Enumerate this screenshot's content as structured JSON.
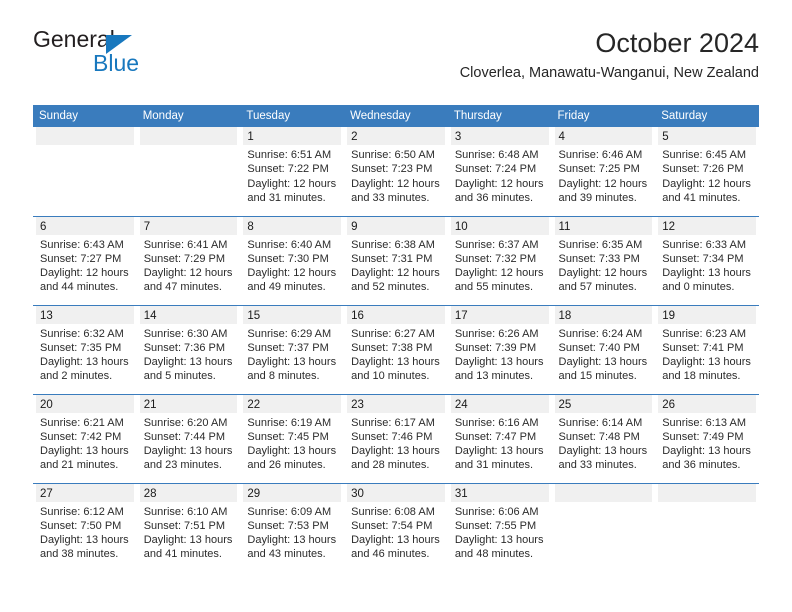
{
  "logo": {
    "word1": "General",
    "word2": "Blue",
    "triangle_color": "#1878be"
  },
  "header": {
    "title": "October 2024",
    "subtitle": "Cloverlea, Manawatu-Wanganui, New Zealand"
  },
  "colors": {
    "header_blue": "#3a7cbd",
    "daynum_band": "#f0f0f0",
    "text": "#1a1a1a"
  },
  "calendar": {
    "weekday_headers": [
      "Sunday",
      "Monday",
      "Tuesday",
      "Wednesday",
      "Thursday",
      "Friday",
      "Saturday"
    ],
    "weeks": [
      [
        {
          "day": "",
          "sunrise": "",
          "sunset": "",
          "daylight_line1": "",
          "daylight_line2": ""
        },
        {
          "day": "",
          "sunrise": "",
          "sunset": "",
          "daylight_line1": "",
          "daylight_line2": ""
        },
        {
          "day": "1",
          "sunrise": "Sunrise: 6:51 AM",
          "sunset": "Sunset: 7:22 PM",
          "daylight_line1": "Daylight: 12 hours",
          "daylight_line2": "and 31 minutes."
        },
        {
          "day": "2",
          "sunrise": "Sunrise: 6:50 AM",
          "sunset": "Sunset: 7:23 PM",
          "daylight_line1": "Daylight: 12 hours",
          "daylight_line2": "and 33 minutes."
        },
        {
          "day": "3",
          "sunrise": "Sunrise: 6:48 AM",
          "sunset": "Sunset: 7:24 PM",
          "daylight_line1": "Daylight: 12 hours",
          "daylight_line2": "and 36 minutes."
        },
        {
          "day": "4",
          "sunrise": "Sunrise: 6:46 AM",
          "sunset": "Sunset: 7:25 PM",
          "daylight_line1": "Daylight: 12 hours",
          "daylight_line2": "and 39 minutes."
        },
        {
          "day": "5",
          "sunrise": "Sunrise: 6:45 AM",
          "sunset": "Sunset: 7:26 PM",
          "daylight_line1": "Daylight: 12 hours",
          "daylight_line2": "and 41 minutes."
        }
      ],
      [
        {
          "day": "6",
          "sunrise": "Sunrise: 6:43 AM",
          "sunset": "Sunset: 7:27 PM",
          "daylight_line1": "Daylight: 12 hours",
          "daylight_line2": "and 44 minutes."
        },
        {
          "day": "7",
          "sunrise": "Sunrise: 6:41 AM",
          "sunset": "Sunset: 7:29 PM",
          "daylight_line1": "Daylight: 12 hours",
          "daylight_line2": "and 47 minutes."
        },
        {
          "day": "8",
          "sunrise": "Sunrise: 6:40 AM",
          "sunset": "Sunset: 7:30 PM",
          "daylight_line1": "Daylight: 12 hours",
          "daylight_line2": "and 49 minutes."
        },
        {
          "day": "9",
          "sunrise": "Sunrise: 6:38 AM",
          "sunset": "Sunset: 7:31 PM",
          "daylight_line1": "Daylight: 12 hours",
          "daylight_line2": "and 52 minutes."
        },
        {
          "day": "10",
          "sunrise": "Sunrise: 6:37 AM",
          "sunset": "Sunset: 7:32 PM",
          "daylight_line1": "Daylight: 12 hours",
          "daylight_line2": "and 55 minutes."
        },
        {
          "day": "11",
          "sunrise": "Sunrise: 6:35 AM",
          "sunset": "Sunset: 7:33 PM",
          "daylight_line1": "Daylight: 12 hours",
          "daylight_line2": "and 57 minutes."
        },
        {
          "day": "12",
          "sunrise": "Sunrise: 6:33 AM",
          "sunset": "Sunset: 7:34 PM",
          "daylight_line1": "Daylight: 13 hours",
          "daylight_line2": "and 0 minutes."
        }
      ],
      [
        {
          "day": "13",
          "sunrise": "Sunrise: 6:32 AM",
          "sunset": "Sunset: 7:35 PM",
          "daylight_line1": "Daylight: 13 hours",
          "daylight_line2": "and 2 minutes."
        },
        {
          "day": "14",
          "sunrise": "Sunrise: 6:30 AM",
          "sunset": "Sunset: 7:36 PM",
          "daylight_line1": "Daylight: 13 hours",
          "daylight_line2": "and 5 minutes."
        },
        {
          "day": "15",
          "sunrise": "Sunrise: 6:29 AM",
          "sunset": "Sunset: 7:37 PM",
          "daylight_line1": "Daylight: 13 hours",
          "daylight_line2": "and 8 minutes."
        },
        {
          "day": "16",
          "sunrise": "Sunrise: 6:27 AM",
          "sunset": "Sunset: 7:38 PM",
          "daylight_line1": "Daylight: 13 hours",
          "daylight_line2": "and 10 minutes."
        },
        {
          "day": "17",
          "sunrise": "Sunrise: 6:26 AM",
          "sunset": "Sunset: 7:39 PM",
          "daylight_line1": "Daylight: 13 hours",
          "daylight_line2": "and 13 minutes."
        },
        {
          "day": "18",
          "sunrise": "Sunrise: 6:24 AM",
          "sunset": "Sunset: 7:40 PM",
          "daylight_line1": "Daylight: 13 hours",
          "daylight_line2": "and 15 minutes."
        },
        {
          "day": "19",
          "sunrise": "Sunrise: 6:23 AM",
          "sunset": "Sunset: 7:41 PM",
          "daylight_line1": "Daylight: 13 hours",
          "daylight_line2": "and 18 minutes."
        }
      ],
      [
        {
          "day": "20",
          "sunrise": "Sunrise: 6:21 AM",
          "sunset": "Sunset: 7:42 PM",
          "daylight_line1": "Daylight: 13 hours",
          "daylight_line2": "and 21 minutes."
        },
        {
          "day": "21",
          "sunrise": "Sunrise: 6:20 AM",
          "sunset": "Sunset: 7:44 PM",
          "daylight_line1": "Daylight: 13 hours",
          "daylight_line2": "and 23 minutes."
        },
        {
          "day": "22",
          "sunrise": "Sunrise: 6:19 AM",
          "sunset": "Sunset: 7:45 PM",
          "daylight_line1": "Daylight: 13 hours",
          "daylight_line2": "and 26 minutes."
        },
        {
          "day": "23",
          "sunrise": "Sunrise: 6:17 AM",
          "sunset": "Sunset: 7:46 PM",
          "daylight_line1": "Daylight: 13 hours",
          "daylight_line2": "and 28 minutes."
        },
        {
          "day": "24",
          "sunrise": "Sunrise: 6:16 AM",
          "sunset": "Sunset: 7:47 PM",
          "daylight_line1": "Daylight: 13 hours",
          "daylight_line2": "and 31 minutes."
        },
        {
          "day": "25",
          "sunrise": "Sunrise: 6:14 AM",
          "sunset": "Sunset: 7:48 PM",
          "daylight_line1": "Daylight: 13 hours",
          "daylight_line2": "and 33 minutes."
        },
        {
          "day": "26",
          "sunrise": "Sunrise: 6:13 AM",
          "sunset": "Sunset: 7:49 PM",
          "daylight_line1": "Daylight: 13 hours",
          "daylight_line2": "and 36 minutes."
        }
      ],
      [
        {
          "day": "27",
          "sunrise": "Sunrise: 6:12 AM",
          "sunset": "Sunset: 7:50 PM",
          "daylight_line1": "Daylight: 13 hours",
          "daylight_line2": "and 38 minutes."
        },
        {
          "day": "28",
          "sunrise": "Sunrise: 6:10 AM",
          "sunset": "Sunset: 7:51 PM",
          "daylight_line1": "Daylight: 13 hours",
          "daylight_line2": "and 41 minutes."
        },
        {
          "day": "29",
          "sunrise": "Sunrise: 6:09 AM",
          "sunset": "Sunset: 7:53 PM",
          "daylight_line1": "Daylight: 13 hours",
          "daylight_line2": "and 43 minutes."
        },
        {
          "day": "30",
          "sunrise": "Sunrise: 6:08 AM",
          "sunset": "Sunset: 7:54 PM",
          "daylight_line1": "Daylight: 13 hours",
          "daylight_line2": "and 46 minutes."
        },
        {
          "day": "31",
          "sunrise": "Sunrise: 6:06 AM",
          "sunset": "Sunset: 7:55 PM",
          "daylight_line1": "Daylight: 13 hours",
          "daylight_line2": "and 48 minutes."
        },
        {
          "day": "",
          "sunrise": "",
          "sunset": "",
          "daylight_line1": "",
          "daylight_line2": ""
        },
        {
          "day": "",
          "sunrise": "",
          "sunset": "",
          "daylight_line1": "",
          "daylight_line2": ""
        }
      ]
    ]
  }
}
